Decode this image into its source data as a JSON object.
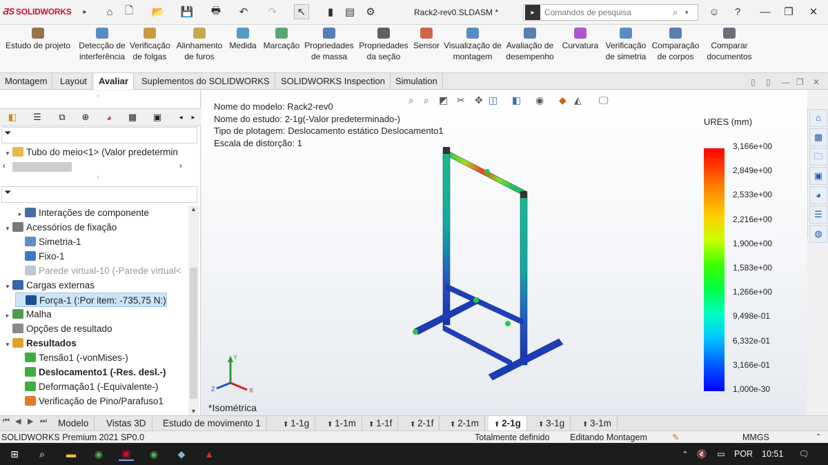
{
  "app": {
    "brand": "SOLIDWORKS",
    "document_title": "Rack2-rev0.SLDASM *"
  },
  "search": {
    "placeholder": "Comandos de pesquisa"
  },
  "ribbon": [
    {
      "id": "design-study",
      "lines": [
        "Estudo de projeto"
      ]
    },
    {
      "id": "interference",
      "lines": [
        "Detecção de",
        "interferência"
      ]
    },
    {
      "id": "clearance",
      "lines": [
        "Verificação",
        "de folgas"
      ]
    },
    {
      "id": "hole-align",
      "lines": [
        "Alinhamento",
        "de furos"
      ]
    },
    {
      "id": "measure",
      "lines": [
        "Medida"
      ]
    },
    {
      "id": "markup",
      "lines": [
        "Marcação"
      ]
    },
    {
      "id": "mass-props",
      "lines": [
        "Propriedades",
        "de massa"
      ]
    },
    {
      "id": "section-props",
      "lines": [
        "Propriedades",
        "da seção"
      ]
    },
    {
      "id": "sensor",
      "lines": [
        "Sensor"
      ]
    },
    {
      "id": "assembly-viz",
      "lines": [
        "Visualização de",
        "montagem"
      ]
    },
    {
      "id": "performance",
      "lines": [
        "Avaliação de",
        "desempenho"
      ]
    },
    {
      "id": "curvature",
      "lines": [
        "Curvatura"
      ]
    },
    {
      "id": "symmetry",
      "lines": [
        "Verificação",
        "de simetria"
      ]
    },
    {
      "id": "compare-bodies",
      "lines": [
        "Comparação",
        "de corpos"
      ]
    },
    {
      "id": "compare-docs",
      "lines": [
        "Comparar",
        "documentos"
      ]
    }
  ],
  "tabs": [
    "Montagem",
    "Layout",
    "Avaliar",
    "Suplementos do SOLIDWORKS",
    "SOLIDWORKS Inspection",
    "Simulation"
  ],
  "active_tab": "Avaliar",
  "tree_top": {
    "item": "Tubo do meio<1> (Valor predetermin"
  },
  "tree": [
    {
      "label": "Interações de componente",
      "indent": 1,
      "arrow": "▸",
      "icon": "#4a6fa5"
    },
    {
      "label": "Acessórios de fixação",
      "indent": 0,
      "arrow": "▾",
      "icon": "#7a7a7a"
    },
    {
      "label": "Simetria-1",
      "indent": 1,
      "arrow": "",
      "icon": "#5a8fc8"
    },
    {
      "label": "Fixo-1",
      "indent": 1,
      "arrow": "",
      "icon": "#3c7ac8"
    },
    {
      "label": "Parede virtual-10 (-Parede virtual<",
      "indent": 1,
      "arrow": "",
      "icon": "#b9c7d6",
      "dim": true
    },
    {
      "label": "Cargas externas",
      "indent": 0,
      "arrow": "▾",
      "icon": "#3566a8"
    },
    {
      "label": "Força-1 (:Por item: -735,75 N:)",
      "indent": 1,
      "arrow": "",
      "icon": "#1b4f91",
      "selected": true
    },
    {
      "label": "Malha",
      "indent": 0,
      "arrow": "▸",
      "icon": "#4e9a4e"
    },
    {
      "label": "Opções de resultado",
      "indent": 0,
      "arrow": "",
      "icon": "#8a8a8a"
    },
    {
      "label": "Resultados",
      "indent": 0,
      "arrow": "▾",
      "icon": "#e0a030",
      "bold": true
    },
    {
      "label": "Tensão1 (-vonMises-)",
      "indent": 1,
      "arrow": "",
      "icon": "#3fae3f"
    },
    {
      "label": "Deslocamento1 (-Res. desl.-)",
      "indent": 1,
      "arrow": "",
      "icon": "#3fae3f",
      "bold": true
    },
    {
      "label": "Deformação1 (-Equivalente-)",
      "indent": 1,
      "arrow": "",
      "icon": "#3fae3f"
    },
    {
      "label": "Verificação de Pino/Parafuso1",
      "indent": 1,
      "arrow": "",
      "icon": "#e07a30"
    }
  ],
  "viewport": {
    "model_name": "Nome do modelo: Rack2-rev0",
    "study_name": "Nome do estudo: 2-1g(-Valor predeterminado-)",
    "plot_type": "Tipo de plotagem: Deslocamento estático Deslocamento1",
    "distortion": "Escala de distorção: 1",
    "view_label": "*Isométrica",
    "legend_title": "URES (mm)",
    "legend_values": [
      "3,166e+00",
      "2,849e+00",
      "2,533e+00",
      "2,216e+00",
      "1,900e+00",
      "1,583e+00",
      "1,266e+00",
      "9,498e-01",
      "6,332e-01",
      "3,166e-01",
      "1,000e-30"
    ],
    "axis_labels": {
      "x": "X",
      "y": "Y",
      "z": "Z"
    }
  },
  "bottom_tabs": [
    {
      "label": "Modelo",
      "icon": false
    },
    {
      "label": "Vistas 3D",
      "icon": false
    },
    {
      "label": "Estudo de movimento 1",
      "icon": false
    },
    {
      "label": "1-1g",
      "icon": true
    },
    {
      "label": "1-1m",
      "icon": true
    },
    {
      "label": "1-1f",
      "icon": true
    },
    {
      "label": "2-1f",
      "icon": true
    },
    {
      "label": "2-1m",
      "icon": true
    },
    {
      "label": "2-1g",
      "icon": true,
      "active": true
    },
    {
      "label": "3-1g",
      "icon": true
    },
    {
      "label": "3-1m",
      "icon": true
    }
  ],
  "status": {
    "product": "SOLIDWORKS Premium 2021 SP0.0",
    "state": "Totalmente definido",
    "mode": "Editando Montagem",
    "units": "MMGS"
  },
  "taskbar": {
    "language": "POR",
    "time": "10:51"
  },
  "colors": {
    "accent": "#c8102e",
    "selection": "#cce4f7",
    "mesh": "#1a3fb8"
  }
}
